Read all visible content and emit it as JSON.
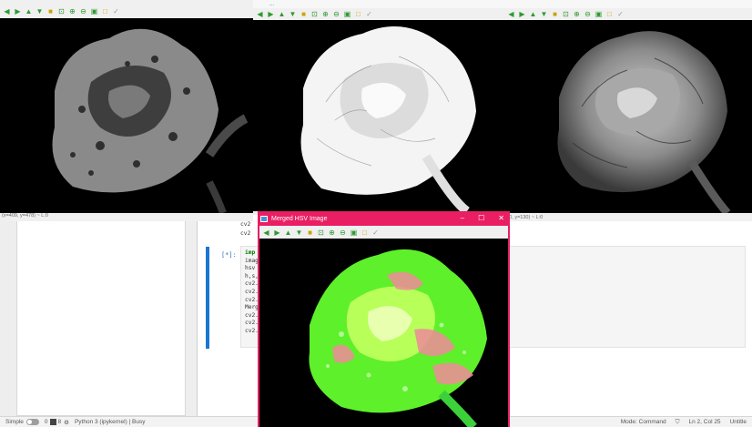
{
  "jupyter": {
    "prompt": "[*]:",
    "code_above": [
      "cv2",
      "cv2"
    ],
    "code_lines": [
      "imp",
      "imag",
      "hsv",
      "h,s,",
      "cv2.",
      "cv2.",
      "cv2.",
      "Merg",
      "cv2.",
      "cv2.",
      "cv2."
    ],
    "status": {
      "mode_label": "Simple",
      "terminals": "0",
      "kernels": "8",
      "kernel": "Python 3 (ipykernel) | Busy",
      "mode": "Mode: Command",
      "position": "Ln 2, Col 25",
      "file": "Untitle"
    }
  },
  "windows": {
    "win1": {
      "coord": "(x=409, y=478) ~ L:0"
    },
    "win2": {
      "title": "..."
    },
    "win3": {
      "coord": "=0, y=130) ~ L:0"
    },
    "merged": {
      "title": "Merged HSV Image",
      "min": "–",
      "max": "☐",
      "close": "✕"
    }
  },
  "toolbar_icons": [
    "arrow-left-icon",
    "arrow-right-icon",
    "arrow-up-icon",
    "arrow-down-icon",
    "image-icon",
    "zoom-region-icon",
    "zoom-in-icon",
    "zoom-out-icon",
    "save-icon",
    "properties-icon",
    "pin-icon"
  ],
  "colors": {
    "merged_titlebar": "#e91e63",
    "cell_bar": "#1976d2",
    "toolbar_green": "#2e9a2e"
  }
}
